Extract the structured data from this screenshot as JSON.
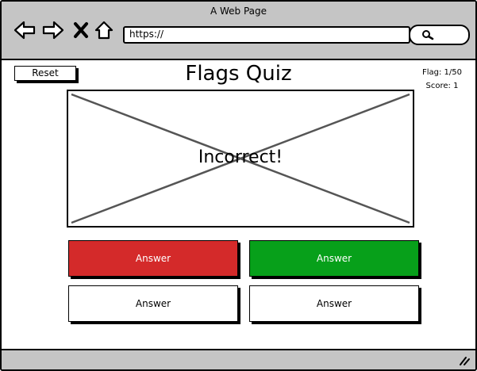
{
  "window": {
    "title": "A Web Page"
  },
  "browser": {
    "url": "https://",
    "icons": [
      "back-arrow-icon",
      "forward-arrow-icon",
      "close-x-icon",
      "home-icon",
      "search-icon"
    ]
  },
  "toolbar": {
    "reset_label": "Reset"
  },
  "page": {
    "title": "Flags Quiz"
  },
  "status": {
    "flag": "Flag: 1/50",
    "score": "Score: 1"
  },
  "flag_area": {
    "message": "Incorrect!"
  },
  "answers": [
    {
      "label": "Answer",
      "state": "incorrect",
      "color": "#d42a2a"
    },
    {
      "label": "Answer",
      "state": "correct",
      "color": "#07a01a"
    },
    {
      "label": "Answer",
      "state": "neutral",
      "color": "#ffffff"
    },
    {
      "label": "Answer",
      "state": "neutral",
      "color": "#ffffff"
    }
  ]
}
